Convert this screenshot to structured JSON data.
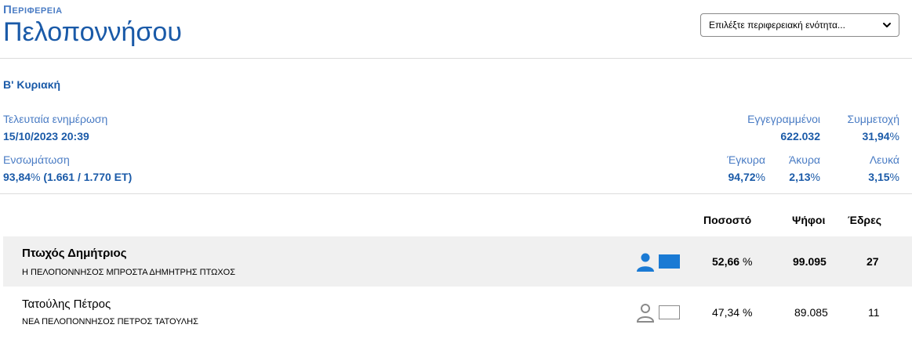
{
  "header": {
    "region_label": "Περιφερεια",
    "region_name": "Πελοποννήσου",
    "unit_select": {
      "placeholder": "Επιλέξτε περιφερειακή ενότητα..."
    }
  },
  "round": "Β' Κυριακή",
  "stats": {
    "last_update_label": "Τελευταία ενημέρωση",
    "last_update_value": "15/10/2023 20:39",
    "registered_label": "Εγγεγραμμένοι",
    "registered_value": "622.032",
    "turnout_label": "Συμμετοχή",
    "turnout_value": "31,94",
    "integration_label": "Ενσωμάτωση",
    "integration_value": "93,84",
    "integration_detail": "(1.661 / 1.770 ΕΤ)",
    "valid_label": "Έγκυρα",
    "valid_value": "94,72",
    "invalid_label": "Άκυρα",
    "invalid_value": "2,13",
    "blank_label": "Λευκά",
    "blank_value": "3,15",
    "percent_sign": "%"
  },
  "table": {
    "headers": {
      "percentage": "Ποσοστό",
      "votes": "Ψήφοι",
      "seats": "Έδρες"
    },
    "rows": [
      {
        "name": "Πτωχός Δημήτριος",
        "party": "Η ΠΕΛΟΠΟΝΝΗΣΟΣ ΜΠΡΟΣΤΑ ΔΗΜΗΤΡΗΣ ΠΤΩΧΟΣ",
        "percentage": "52,66",
        "votes": "99.095",
        "seats": "27",
        "icon": "person-icon"
      },
      {
        "name": "Τατούλης Πέτρος",
        "party": "ΝΕΑ ΠΕΛΟΠΟΝΝΗΣΟΣ ΠΕΤΡΟΣ ΤΑΤΟΥΛΗΣ",
        "percentage": "47,34",
        "votes": "89.085",
        "seats": "11",
        "icon": "person-outline-icon"
      }
    ]
  },
  "colors": {
    "accent": "#1a5aa8",
    "label": "#4a7cc4",
    "winner": "#1a7ad4",
    "muted": "#8a8a8a",
    "row_highlight": "#f0f0f0"
  }
}
